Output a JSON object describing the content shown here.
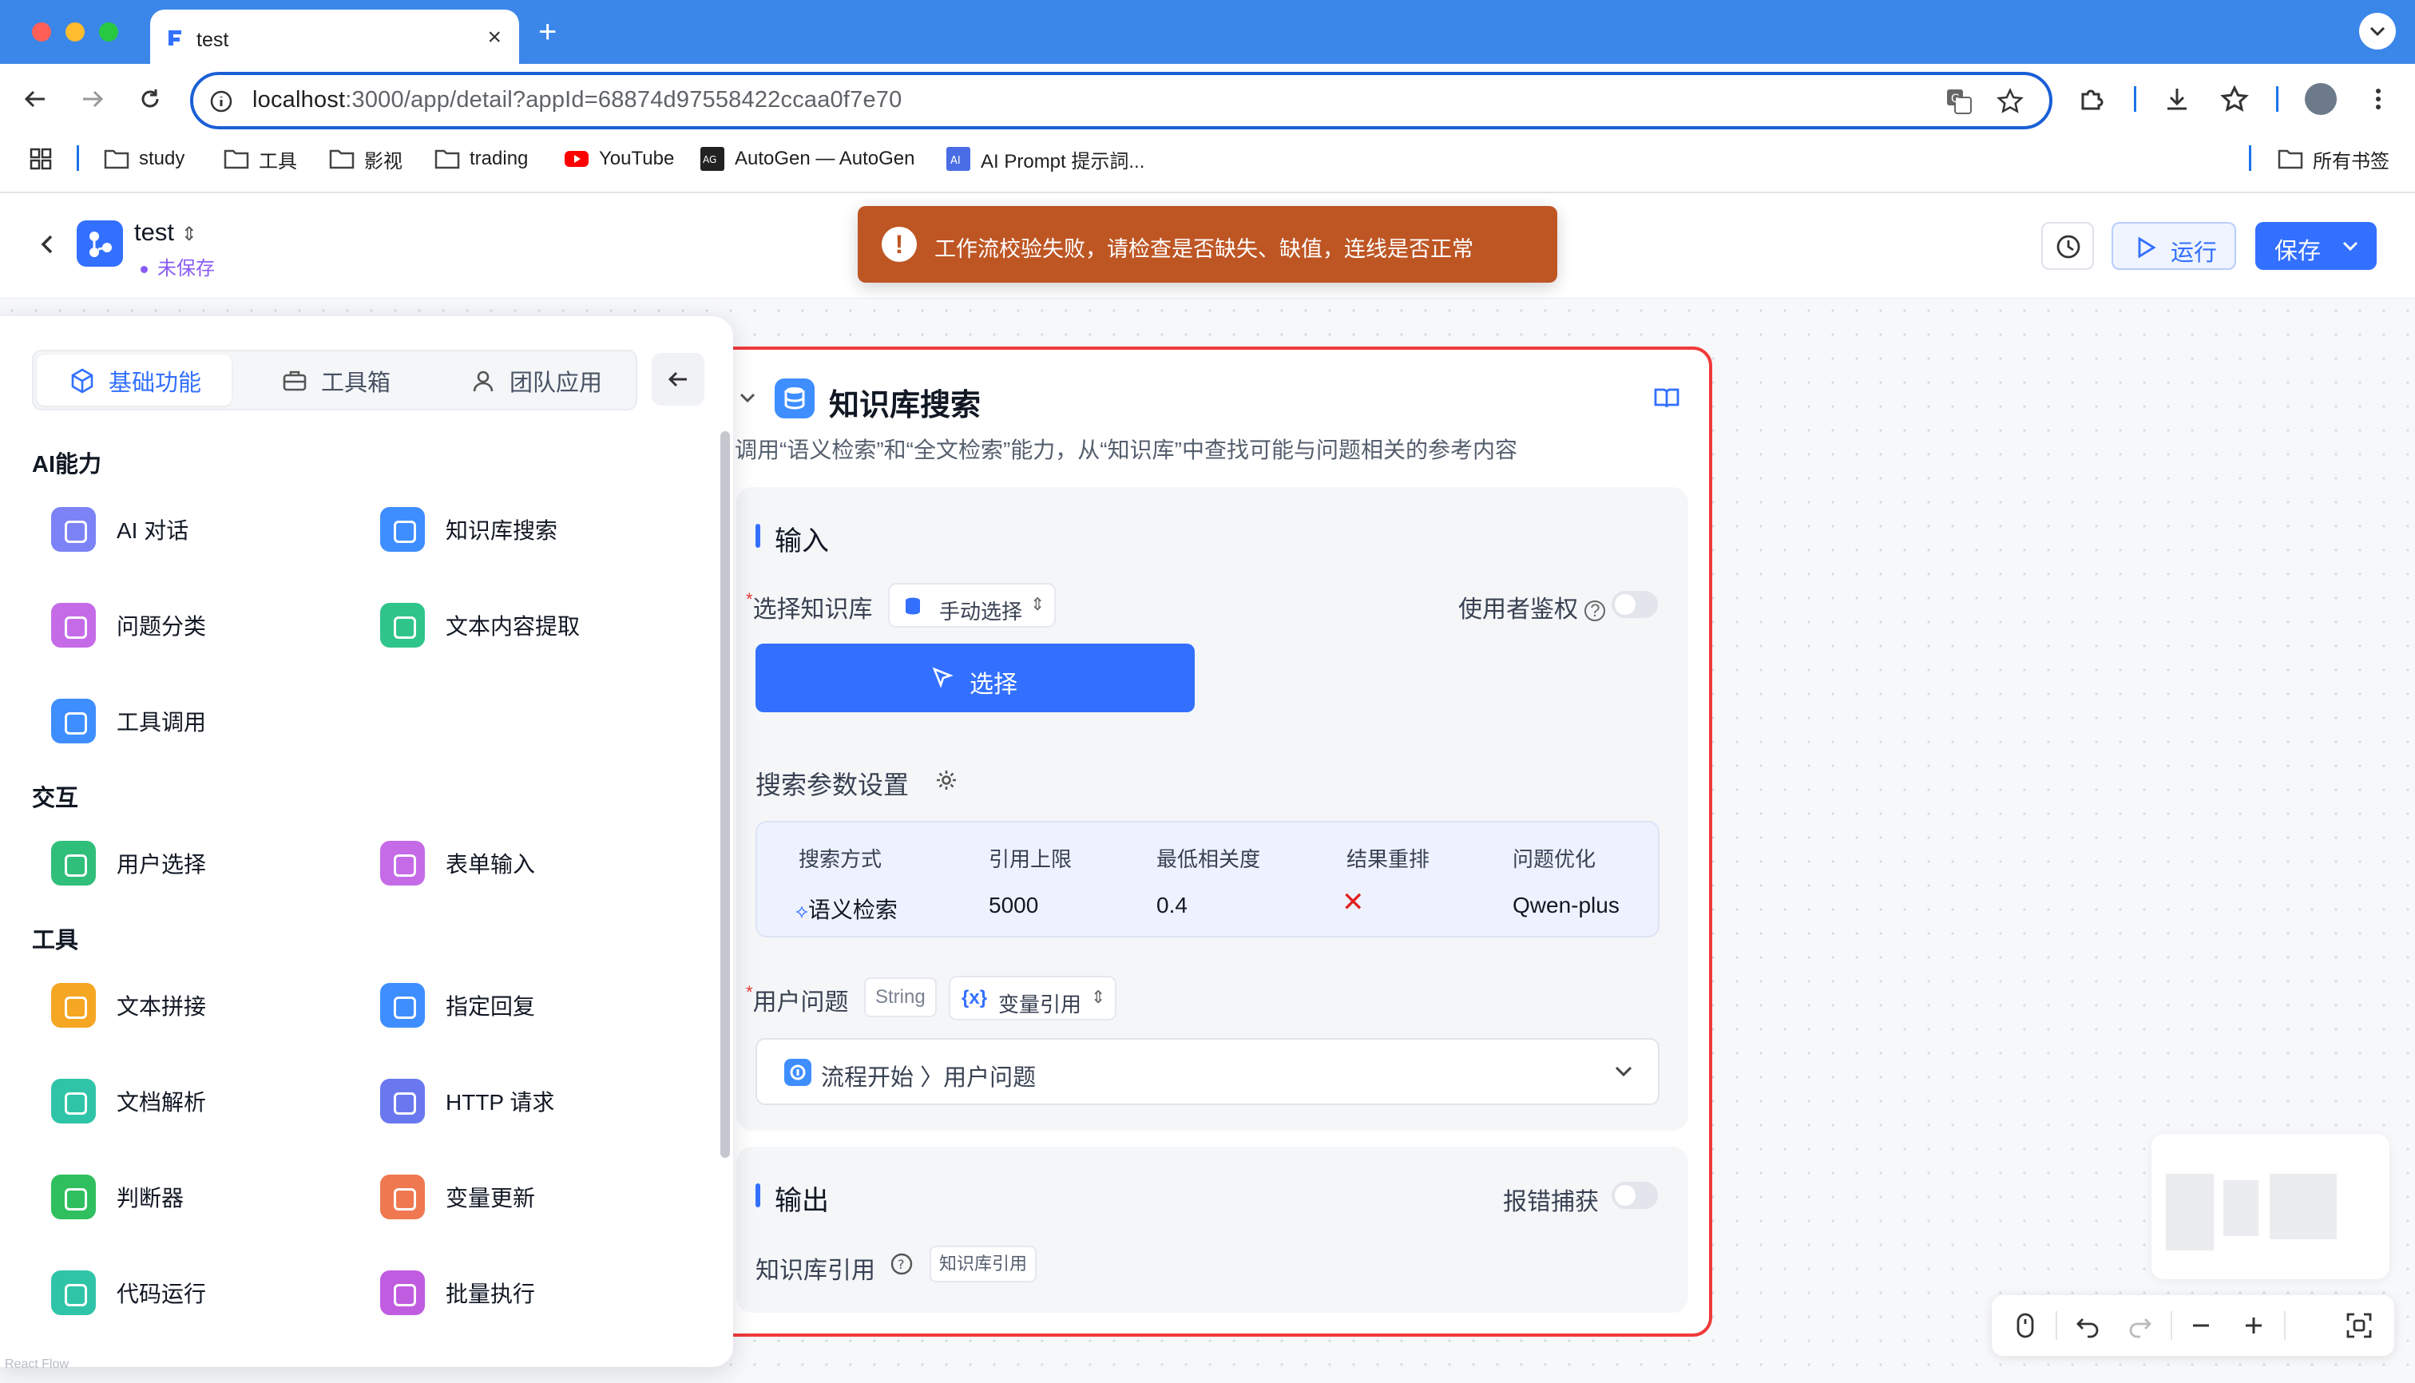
{
  "browser": {
    "tab_title": "test",
    "url_host": "localhost",
    "url_rest": ":3000/app/detail?appId=68874d97558422ccaa0f7e70",
    "bookmarks": [
      "study",
      "工具",
      "影视",
      "trading",
      "YouTube",
      "AutoGen — AutoGen",
      "AI Prompt 提示詞..."
    ],
    "all_bookmarks": "所有书签"
  },
  "header": {
    "app_name": "test",
    "status": "未保存",
    "alert": "工作流校验失败，请检查是否缺失、缺值，连线是否正常",
    "alert_icon": "!",
    "run_label": "运行",
    "save_label": "保存"
  },
  "panel": {
    "tabs": [
      "基础功能",
      "工具箱",
      "团队应用"
    ],
    "groups": [
      {
        "title": "AI能力",
        "items": [
          {
            "label": "AI 对话",
            "color": "#7b83f6"
          },
          {
            "label": "知识库搜索",
            "color": "#3e8eff"
          },
          {
            "label": "问题分类",
            "color": "#c56be8"
          },
          {
            "label": "文本内容提取",
            "color": "#2fc48a"
          },
          {
            "label": "工具调用",
            "color": "#3e8eff"
          }
        ]
      },
      {
        "title": "交互",
        "items": [
          {
            "label": "用户选择",
            "color": "#2fbf7a"
          },
          {
            "label": "表单输入",
            "color": "#c56be8"
          }
        ]
      },
      {
        "title": "工具",
        "items": [
          {
            "label": "文本拼接",
            "color": "#f5a623"
          },
          {
            "label": "指定回复",
            "color": "#3e8eff"
          },
          {
            "label": "文档解析",
            "color": "#2fc4a8"
          },
          {
            "label": "HTTP 请求",
            "color": "#6a78f0"
          },
          {
            "label": "判断器",
            "color": "#2fbf5f"
          },
          {
            "label": "变量更新",
            "color": "#f07850"
          },
          {
            "label": "代码运行",
            "color": "#2fc4a8"
          },
          {
            "label": "批量执行",
            "color": "#c05ce0"
          }
        ]
      }
    ],
    "footer": "React Flow"
  },
  "node": {
    "title": "知识库搜索",
    "description": "调用“语义检索”和“全文检索”能力，从“知识库”中查找可能与问题相关的参考内容",
    "input_title": "输入",
    "kb_label": "选择知识库",
    "kb_mode": "手动选择",
    "auth_label": "使用者鉴权",
    "select_button": "选择",
    "params_title": "搜索参数设置",
    "params_headers": [
      "搜索方式",
      "引用上限",
      "最低相关度",
      "结果重排",
      "问题优化"
    ],
    "params_values": [
      "语义检索",
      "5000",
      "0.4",
      "✕",
      "Qwen-plus"
    ],
    "question_label": "用户问题",
    "question_type": "String",
    "question_mode": "变量引用",
    "question_value_start": "流程开始",
    "question_value_field": "用户问题",
    "output_title": "输出",
    "catch_label": "报错捕获",
    "kb_ref_label": "知识库引用",
    "kb_ref_tag": "知识库引用"
  },
  "colors": {
    "accent": "#3370ff",
    "error": "#f03a3a",
    "alert_bg": "#be5624",
    "browser_blue": "#3b86e9"
  }
}
